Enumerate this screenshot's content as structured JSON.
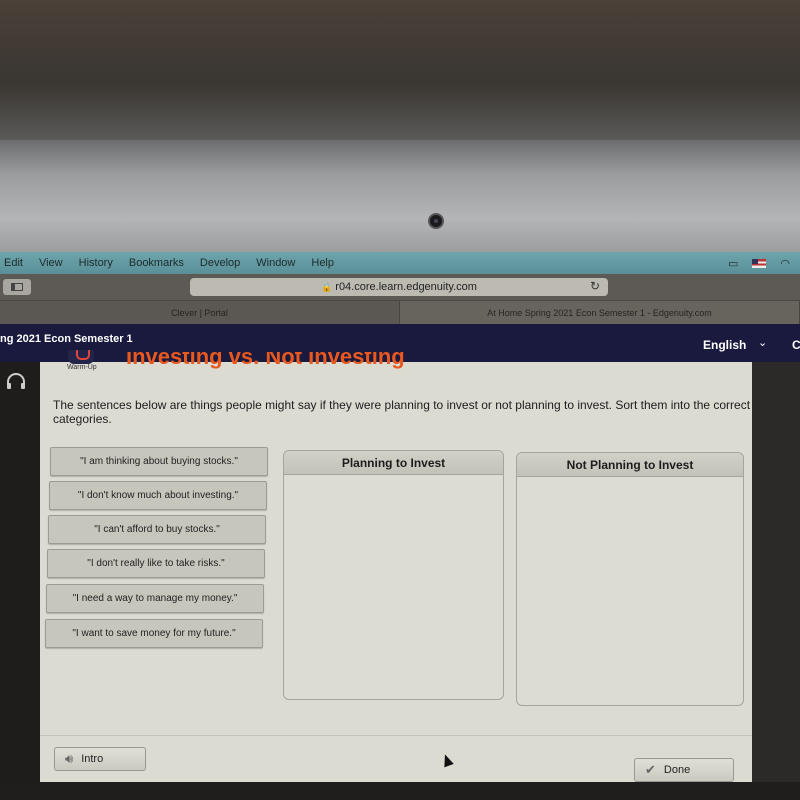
{
  "menubar": {
    "items": [
      "Edit",
      "View",
      "History",
      "Bookmarks",
      "Develop",
      "Window",
      "Help"
    ],
    "tray_icons": [
      "airplay-icon",
      "flag-us-icon",
      "wifi-icon"
    ]
  },
  "browser": {
    "url": "r04.core.learn.edgenuity.com",
    "tabs": [
      {
        "label": "Clever | Portal",
        "active": false
      },
      {
        "label": "At Home Spring 2021 Econ Semester 1 - Edgenuity.com",
        "active": true
      }
    ]
  },
  "app_header": {
    "course_title": "ng 2021 Econ Semester 1",
    "language": "English",
    "language_chevron": "⌄",
    "truncated_right": "C"
  },
  "activity": {
    "section_label": "Warm-Up",
    "title": "Investing vs. Not Investing",
    "instructions": "The sentences below are things people might say if they were planning to invest or not planning to invest. Sort them into the correct categories.",
    "cards": [
      "\"I am thinking about buying stocks.\"",
      "\"I don't know much about investing.\"",
      "\"I can't afford to buy stocks.\"",
      "\"I don't really like to take risks.\"",
      "\"I need a way to manage my money.\"",
      "\"I want to save money for my future.\""
    ],
    "categories": [
      {
        "label": "Planning to Invest",
        "items": []
      },
      {
        "label": "Not Planning to Invest",
        "items": []
      }
    ]
  },
  "footer": {
    "intro_label": "Intro",
    "done_label": "Done"
  }
}
